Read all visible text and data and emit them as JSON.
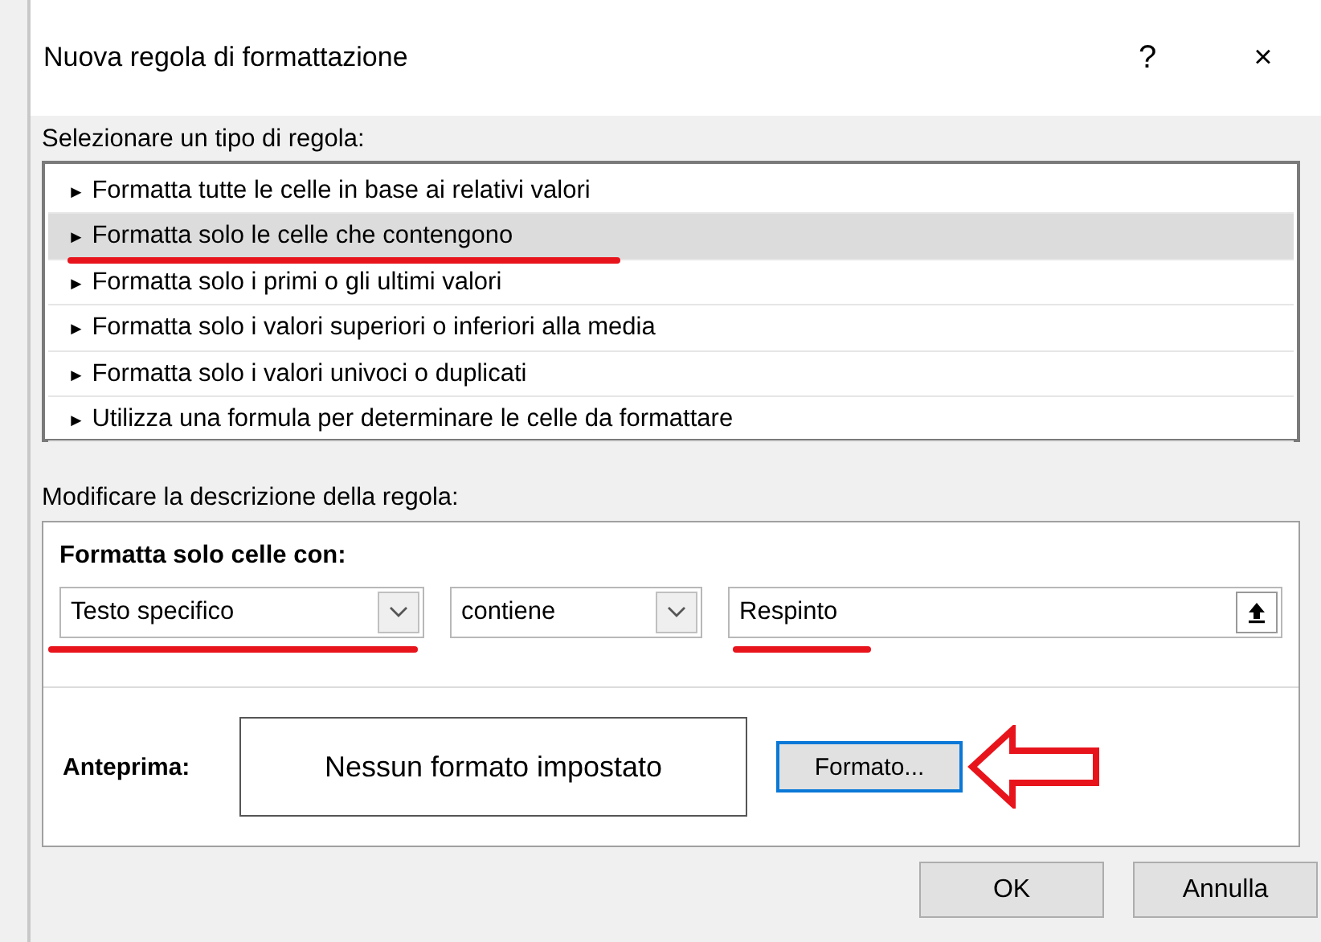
{
  "window": {
    "title": "Nuova regola di formattazione",
    "help": "?",
    "close": "×"
  },
  "rule_types": {
    "label": "Selezionare un tipo di regola:",
    "items": [
      {
        "bullet": "►",
        "label": "Formatta tutte le celle in base ai relativi valori",
        "selected": false,
        "annotated": false
      },
      {
        "bullet": "►",
        "label": "Formatta solo le celle che contengono",
        "selected": true,
        "annotated": true
      },
      {
        "bullet": "►",
        "label": "Formatta solo i primi o gli ultimi valori",
        "selected": false,
        "annotated": false
      },
      {
        "bullet": "►",
        "label": "Formatta solo i valori superiori o inferiori alla media",
        "selected": false,
        "annotated": false
      },
      {
        "bullet": "►",
        "label": "Formatta solo i valori univoci o duplicati",
        "selected": false,
        "annotated": false
      },
      {
        "bullet": "►",
        "label": "Utilizza una formula per determinare le celle da formattare",
        "selected": false,
        "annotated": false
      }
    ]
  },
  "description": {
    "label": "Modificare la descrizione della regola:",
    "heading": "Formatta solo celle con:",
    "condition_type": {
      "value": "Testo specifico",
      "annotated": true
    },
    "operator": {
      "value": "contiene"
    },
    "text_value": {
      "value": "Respinto",
      "annotated": true
    },
    "preview_label": "Anteprima:",
    "preview_text": "Nessun formato impostato",
    "format_button": {
      "label": "Formato...",
      "focused": true,
      "annotated": true
    }
  },
  "buttons": [
    "OK",
    "Annulla"
  ]
}
